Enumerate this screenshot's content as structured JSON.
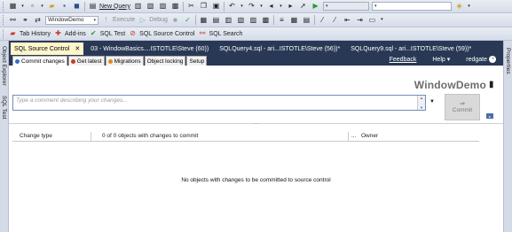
{
  "toolbar1": {
    "new_query_label": "New Query"
  },
  "toolbar2": {
    "database_selected": "WindowDemo",
    "execute_label": "Execute",
    "debug_label": "Debug"
  },
  "toolbar3": {
    "tab_history_label": "Tab History",
    "addins_label": "Add-ins",
    "sql_test_label": "SQL Test",
    "sql_source_control_label": "SQL Source Control",
    "sql_search_label": "SQL Search"
  },
  "left_strip": {
    "object_explorer_label": "Object Explorer",
    "sql_test_label": "SQL Test"
  },
  "right_strip": {
    "properties_label": "Properties"
  },
  "doc_tabs": [
    {
      "label": "SQL Source Control"
    },
    {
      "label": "03 - WindowBasics....ISTOTLE\\Steve (60))"
    },
    {
      "label": "SQLQuery4.sql - ari...ISTOTLE\\Steve (56))*"
    },
    {
      "label": "SQLQuery9.sql - ari...ISTOTLE\\Steve (59))*"
    }
  ],
  "panel_tabs": [
    {
      "label": "Commit changes",
      "color": "#2f6fc4"
    },
    {
      "label": "Get latest",
      "color": "#c83a2a"
    },
    {
      "label": "Migrations",
      "color": "#e08a1e"
    },
    {
      "label": "Object locking"
    },
    {
      "label": "Setup"
    }
  ],
  "header": {
    "feedback_label": "Feedback",
    "help_label": "Help",
    "help_arrow": "▾",
    "brand": "redgate"
  },
  "database_title": "WindowDemo",
  "comment": {
    "placeholder": "Type a comment describing your changes..."
  },
  "commit_button": {
    "label": "Commit"
  },
  "table": {
    "col_type": "Change type",
    "col_summary": "0 of 0 objects with changes to commit",
    "col_ellipsis": "...",
    "col_owner": "Owner"
  },
  "empty_message": "No objects with changes to be committed to source control",
  "colors": {
    "toolbar_bg": "#dfe5ee",
    "tab_strip_bg": "#293955",
    "active_tab_bg": "#fff6cc",
    "commit_button_bg": "#d9d9d9"
  }
}
